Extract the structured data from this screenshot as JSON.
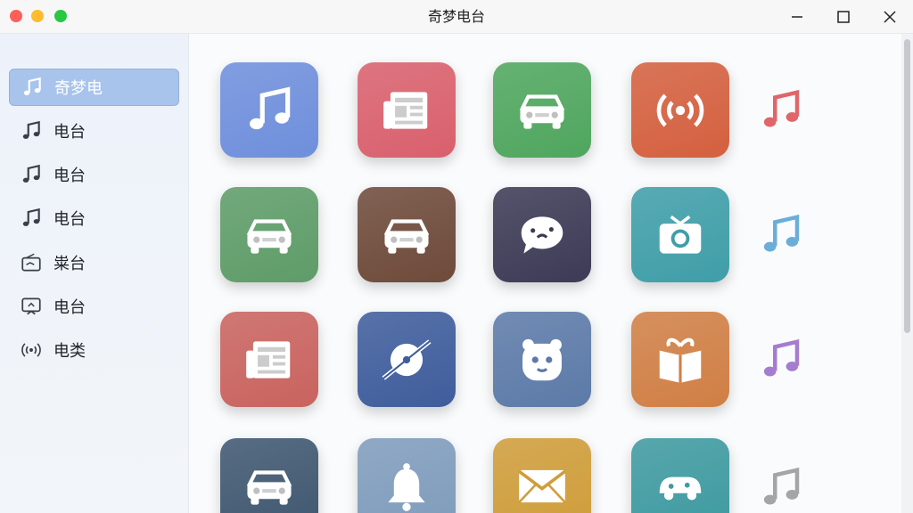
{
  "window": {
    "title": "奇梦电台"
  },
  "sidebar": {
    "items": [
      {
        "label": "奇梦电",
        "icon": "music-note-icon",
        "active": true
      },
      {
        "label": "电台",
        "icon": "music-note-icon",
        "active": false
      },
      {
        "label": "电台",
        "icon": "music-note-icon",
        "active": false
      },
      {
        "label": "电台",
        "icon": "music-note-icon",
        "active": false
      },
      {
        "label": "粜台",
        "icon": "radio-device-icon",
        "active": false
      },
      {
        "label": "电台",
        "icon": "cast-screen-icon",
        "active": false
      },
      {
        "label": "电类",
        "icon": "broadcast-waves-icon",
        "active": false
      }
    ]
  },
  "grid": {
    "tiles": [
      {
        "icon": "music-note-icon",
        "color": "#6f8fdc"
      },
      {
        "icon": "newspaper-icon",
        "color": "#d9606d"
      },
      {
        "icon": "car-icon",
        "color": "#4fa65e"
      },
      {
        "icon": "broadcast-icon",
        "color": "#d4603f"
      },
      {
        "icon": "car-icon",
        "color": "#5e9c68"
      },
      {
        "icon": "car-icon",
        "color": "#6e4a3a"
      },
      {
        "icon": "chat-bubble-icon",
        "color": "#3c3a55"
      },
      {
        "icon": "camera-icon",
        "color": "#3f9ea8"
      },
      {
        "icon": "newspaper-icon",
        "color": "#c9635f"
      },
      {
        "icon": "planet-icon",
        "color": "#3f5d9c"
      },
      {
        "icon": "panda-face-icon",
        "color": "#5c7aa8"
      },
      {
        "icon": "gift-book-icon",
        "color": "#d07f45"
      },
      {
        "icon": "car-icon",
        "color": "#3f5770"
      },
      {
        "icon": "bell-icon",
        "color": "#7f9cbc"
      },
      {
        "icon": "envelope-icon",
        "color": "#cf9d3a"
      },
      {
        "icon": "vehicle-icon",
        "color": "#3e9aa0"
      }
    ],
    "loose_notes": [
      {
        "icon": "music-note-icon",
        "color": "#e0666a"
      },
      {
        "icon": "music-note-icon",
        "color": "#6aaed8"
      },
      {
        "icon": "music-note-icon",
        "color": "#a57ccf"
      },
      {
        "icon": "music-note-icon",
        "color": "#a5a5a8"
      }
    ]
  }
}
